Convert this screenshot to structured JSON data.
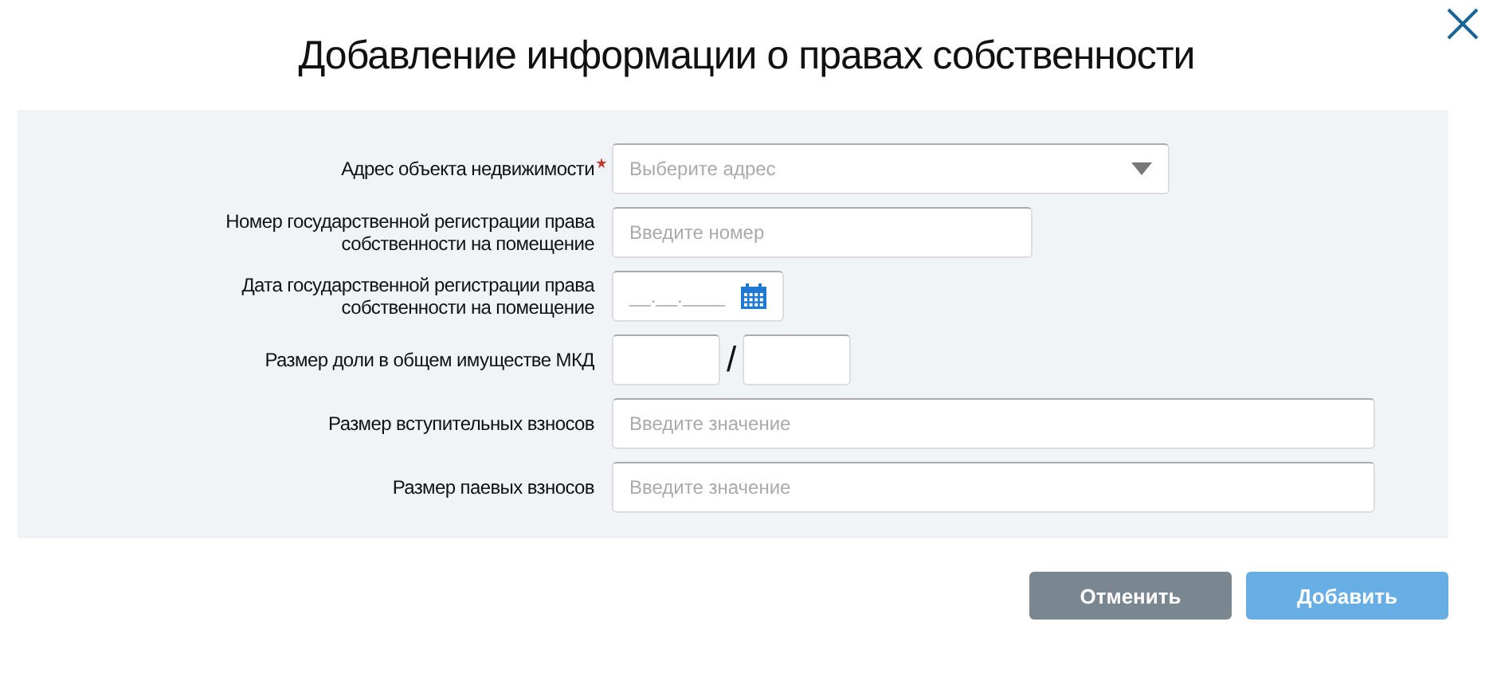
{
  "dialog": {
    "title": "Добавление информации о правах собственности"
  },
  "fields": [
    {
      "kind": "select",
      "label": "Адрес объекта недвижимости",
      "required": true,
      "placeholder": "Выберите адрес"
    },
    {
      "kind": "text",
      "label": "Номер государственной регистрации права собственности на помещение",
      "required": false,
      "placeholder": "Введите номер"
    },
    {
      "kind": "date",
      "label": "Дата государственной регистрации права собственности на помещение",
      "required": false,
      "placeholder": "__.__.____"
    },
    {
      "kind": "fraction",
      "label": "Размер доли в общем имуществе МКД",
      "required": false,
      "separator": "/"
    },
    {
      "kind": "wide",
      "label": "Размер вступительных взносов",
      "required": false,
      "placeholder": "Введите значение"
    },
    {
      "kind": "wide",
      "label": "Размер паевых взносов",
      "required": false,
      "placeholder": "Введите значение"
    }
  ],
  "buttons": [
    {
      "kind": "cancel",
      "label": "Отменить",
      "disabled": false
    },
    {
      "kind": "primary",
      "label": "Добавить",
      "disabled": true
    }
  ]
}
